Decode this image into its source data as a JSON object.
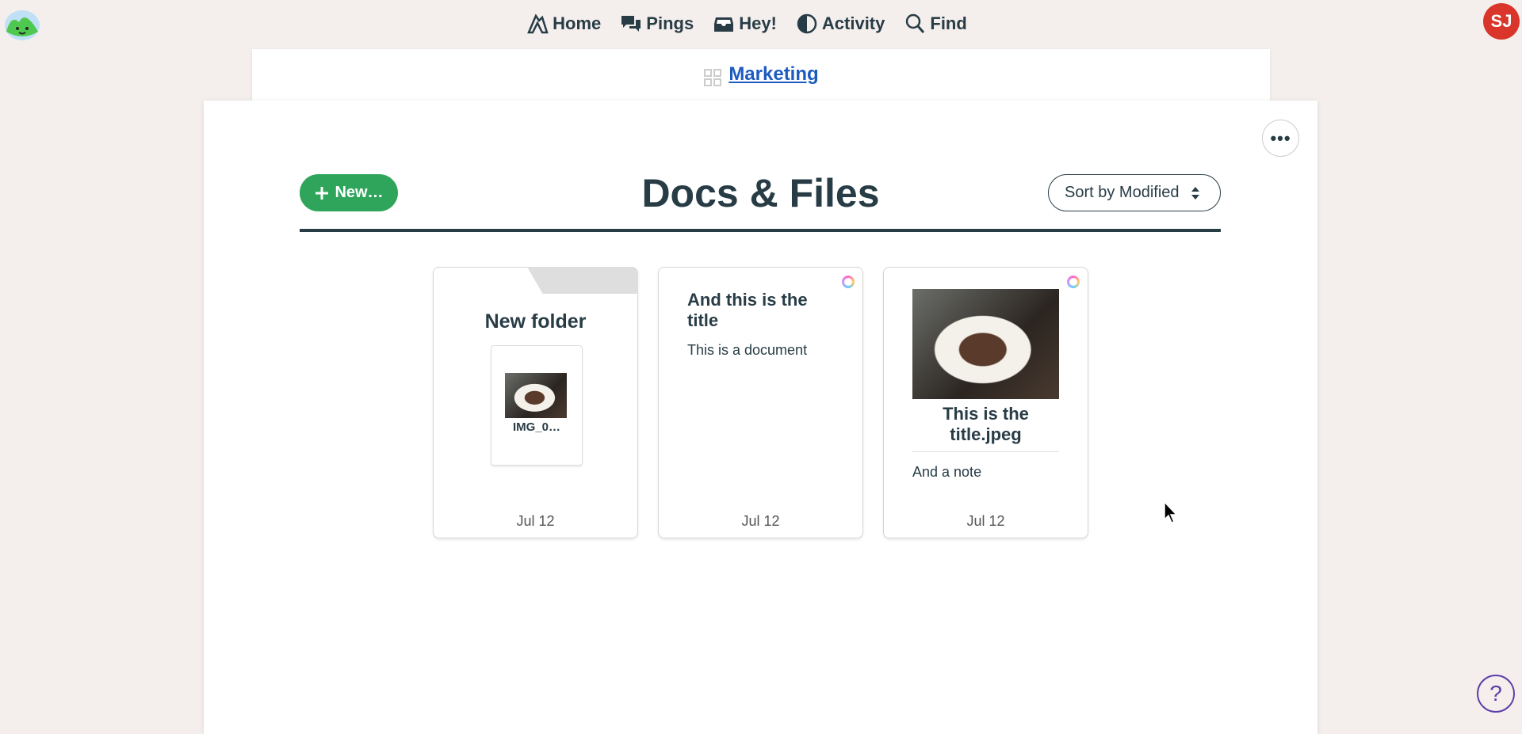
{
  "nav": {
    "items": [
      {
        "label": "Home",
        "icon": "home-icon"
      },
      {
        "label": "Pings",
        "icon": "pings-icon"
      },
      {
        "label": "Hey!",
        "icon": "inbox-icon"
      },
      {
        "label": "Activity",
        "icon": "activity-icon"
      },
      {
        "label": "Find",
        "icon": "search-icon"
      }
    ]
  },
  "user": {
    "initials": "SJ",
    "color": "#d9352b"
  },
  "breadcrumb": {
    "project": "Marketing"
  },
  "toolbar": {
    "new_label": "New…",
    "title": "Docs & Files",
    "sort_label": "Sort by Modified",
    "more_label": "•••"
  },
  "items": [
    {
      "type": "folder",
      "title": "New folder",
      "child": "IMG_0…",
      "date": "Jul 12"
    },
    {
      "type": "document",
      "title": "And this is the title",
      "body": "This is a document",
      "date": "Jul 12"
    },
    {
      "type": "image",
      "title": "This is the title.jpeg",
      "note": "And a note",
      "date": "Jul 12"
    }
  ],
  "colors": {
    "accent": "#2ea55a",
    "link": "#1d5bbf",
    "text": "#283c46",
    "background": "#f4efed"
  },
  "help": {
    "label": "?"
  }
}
